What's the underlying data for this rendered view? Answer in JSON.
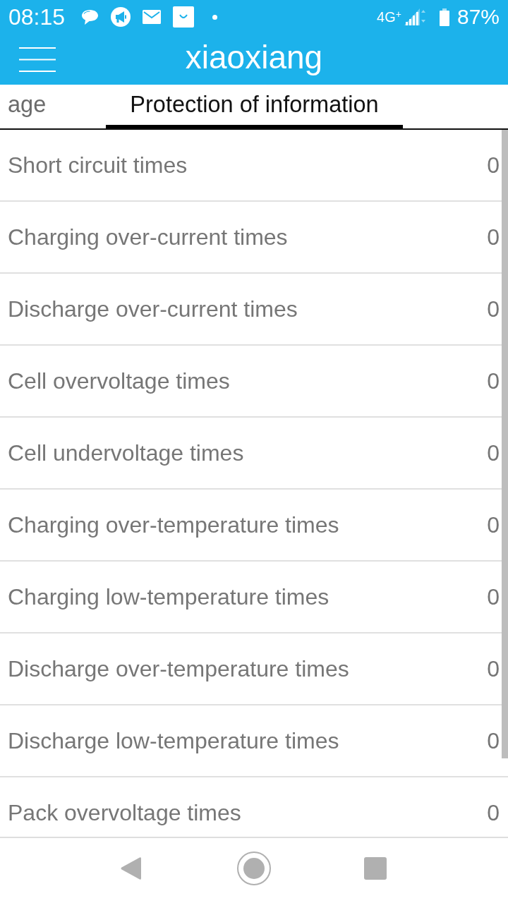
{
  "status_bar": {
    "time": "08:15",
    "network": "4G$^{+}$",
    "battery": "87%"
  },
  "app_bar": {
    "title": "xiaoxiang"
  },
  "tabs": [
    {
      "label": "age",
      "selected": false
    },
    {
      "label": "Protection of information",
      "selected": true
    }
  ],
  "rows": [
    {
      "label": "Short circuit times",
      "value": "0"
    },
    {
      "label": "Charging over-current times",
      "value": "0"
    },
    {
      "label": "Discharge over-current times",
      "value": "0"
    },
    {
      "label": "Cell overvoltage times",
      "value": "0"
    },
    {
      "label": "Cell undervoltage times",
      "value": "0"
    },
    {
      "label": "Charging over-temperature times",
      "value": "0"
    },
    {
      "label": "Charging low-temperature times",
      "value": "0"
    },
    {
      "label": "Discharge over-temperature times",
      "value": "0"
    },
    {
      "label": "Discharge low-temperature times",
      "value": "0"
    },
    {
      "label": "Pack overvoltage times",
      "value": "0"
    }
  ]
}
